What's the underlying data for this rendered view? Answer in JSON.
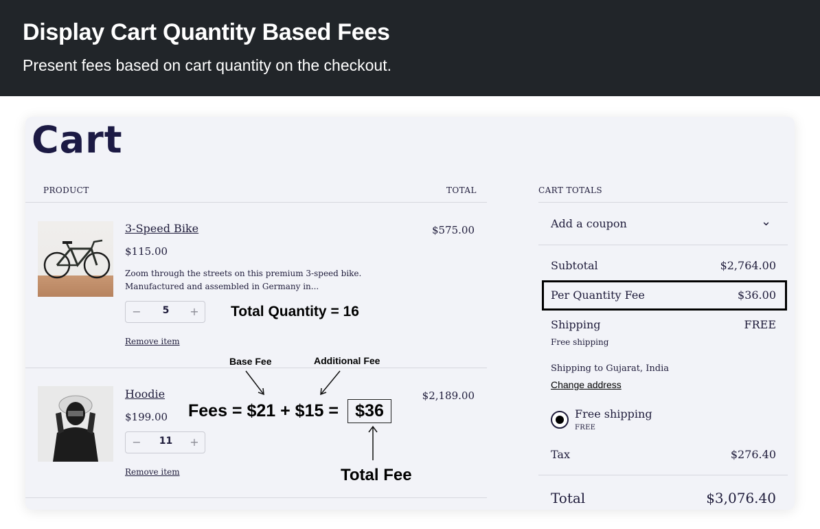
{
  "banner": {
    "title": "Display Cart Quantity Based Fees",
    "subtitle": "Present fees based on cart quantity on the checkout."
  },
  "cart": {
    "title": "Cart",
    "columns": {
      "product": "PRODUCT",
      "total": "TOTAL"
    },
    "items": [
      {
        "name": "3-Speed Bike",
        "price": "$115.00",
        "description_line1": "Zoom through the streets on this premium 3-speed bike.",
        "description_line2": "Manufactured and assembled in Germany in...",
        "quantity": "5",
        "line_total": "$575.00",
        "remove_label": "Remove item"
      },
      {
        "name": "Hoodie",
        "price": "$199.00",
        "quantity": "11",
        "line_total": "$2,189.00",
        "remove_label": "Remove item"
      }
    ]
  },
  "totals": {
    "heading": "CART TOTALS",
    "coupon_label": "Add a coupon",
    "subtotal_label": "Subtotal",
    "subtotal_value": "$2,764.00",
    "fee_label": "Per Quantity Fee",
    "fee_value": "$36.00",
    "shipping_label": "Shipping",
    "shipping_value": "FREE",
    "shipping_method": "Free shipping",
    "shipping_to": "Shipping to Gujarat, India",
    "change_address": "Change address",
    "option_label": "Free shipping",
    "option_price": "FREE",
    "tax_label": "Tax",
    "tax_value": "$276.40",
    "total_label": "Total",
    "total_value": "$3,076.40"
  },
  "annotations": {
    "total_quantity": "Total Quantity = 16",
    "base_fee": "Base Fee",
    "additional_fee": "Additional Fee",
    "formula_prefix": "Fees = $21 + $15 =",
    "formula_result": "$36",
    "total_fee": "Total Fee"
  },
  "icons": {
    "minus": "−",
    "plus": "+",
    "chevron": "⌄"
  }
}
